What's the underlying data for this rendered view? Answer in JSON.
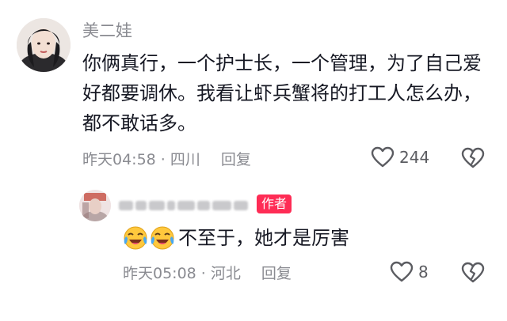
{
  "comment": {
    "username": "美二娃",
    "text": "你俩真行，一个护士长，一个管理，为了自己爱好都要调休。我看让虾兵蟹将的打工人怎么办，都不敢话多。",
    "time": "昨天04:58",
    "separator": "·",
    "location": "四川",
    "reply_label": "回复",
    "like_count": "244"
  },
  "reply": {
    "author_badge": "作者",
    "text": "不至于，她才是厉害",
    "emoji_count": 2,
    "time": "昨天05:08",
    "separator": "·",
    "location": "河北",
    "reply_label": "回复",
    "like_count": "8"
  },
  "colors": {
    "text_primary": "#161823",
    "text_secondary": "#8a8b91",
    "author_badge": "#fe2c55"
  },
  "icons": {
    "like": "heart-outline-icon",
    "dislike": "broken-heart-icon",
    "emoji": "laughing-crying-emoji-icon"
  }
}
